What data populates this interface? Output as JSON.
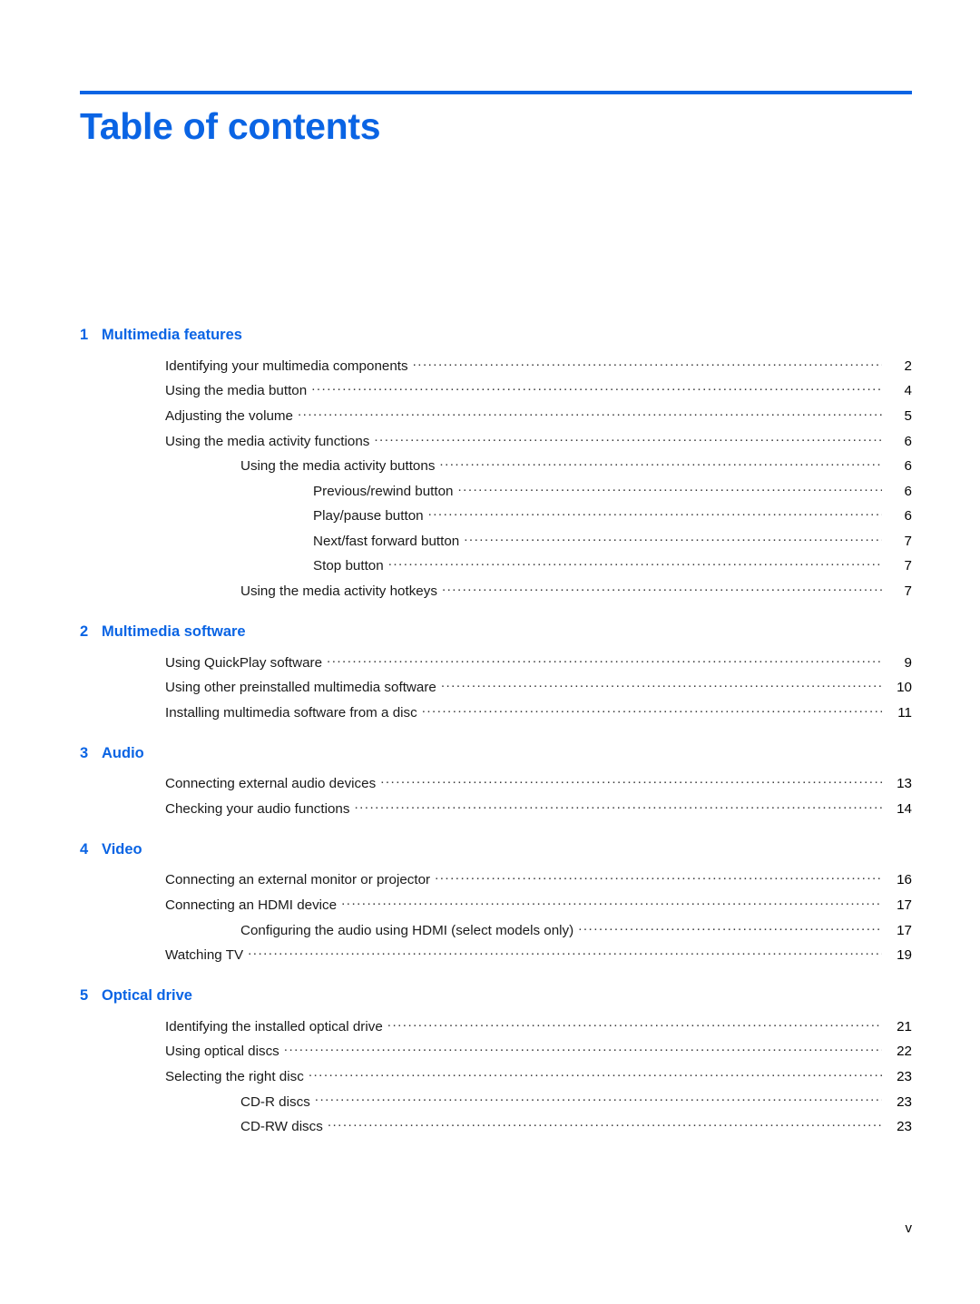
{
  "document": {
    "title": "Table of contents",
    "accent_color": "#0a64e4",
    "text_color": "#000000",
    "footer_page_label": "v"
  },
  "toc": {
    "chapters": [
      {
        "number": "1",
        "title": "Multimedia features",
        "entries": [
          {
            "level": 1,
            "label": "Identifying your multimedia components",
            "page": "2"
          },
          {
            "level": 1,
            "label": "Using the media button",
            "page": "4"
          },
          {
            "level": 1,
            "label": "Adjusting the volume",
            "page": "5"
          },
          {
            "level": 1,
            "label": "Using the media activity functions",
            "page": "6"
          },
          {
            "level": 2,
            "label": "Using the media activity buttons",
            "page": "6"
          },
          {
            "level": 3,
            "label": "Previous/rewind button",
            "page": "6"
          },
          {
            "level": 3,
            "label": "Play/pause button",
            "page": "6"
          },
          {
            "level": 3,
            "label": "Next/fast forward button",
            "page": "7"
          },
          {
            "level": 3,
            "label": "Stop button",
            "page": "7"
          },
          {
            "level": 2,
            "label": "Using the media activity hotkeys",
            "page": "7"
          }
        ]
      },
      {
        "number": "2",
        "title": "Multimedia software",
        "entries": [
          {
            "level": 1,
            "label": "Using QuickPlay software",
            "page": "9"
          },
          {
            "level": 1,
            "label": "Using other preinstalled multimedia software",
            "page": "10"
          },
          {
            "level": 1,
            "label": "Installing multimedia software from a disc",
            "page": "11"
          }
        ]
      },
      {
        "number": "3",
        "title": "Audio",
        "entries": [
          {
            "level": 1,
            "label": "Connecting external audio devices",
            "page": "13"
          },
          {
            "level": 1,
            "label": "Checking your audio functions",
            "page": "14"
          }
        ]
      },
      {
        "number": "4",
        "title": "Video",
        "entries": [
          {
            "level": 1,
            "label": "Connecting an external monitor or projector",
            "page": "16"
          },
          {
            "level": 1,
            "label": "Connecting an HDMI device",
            "page": "17"
          },
          {
            "level": 2,
            "label": "Configuring the audio using HDMI (select models only)",
            "page": "17"
          },
          {
            "level": 1,
            "label": "Watching TV",
            "page": "19"
          }
        ]
      },
      {
        "number": "5",
        "title": "Optical drive",
        "entries": [
          {
            "level": 1,
            "label": "Identifying the installed optical drive",
            "page": "21"
          },
          {
            "level": 1,
            "label": "Using optical discs",
            "page": "22"
          },
          {
            "level": 1,
            "label": "Selecting the right disc",
            "page": "23"
          },
          {
            "level": 2,
            "label": "CD-R discs",
            "page": "23"
          },
          {
            "level": 2,
            "label": "CD-RW discs",
            "page": "23"
          }
        ]
      }
    ]
  }
}
